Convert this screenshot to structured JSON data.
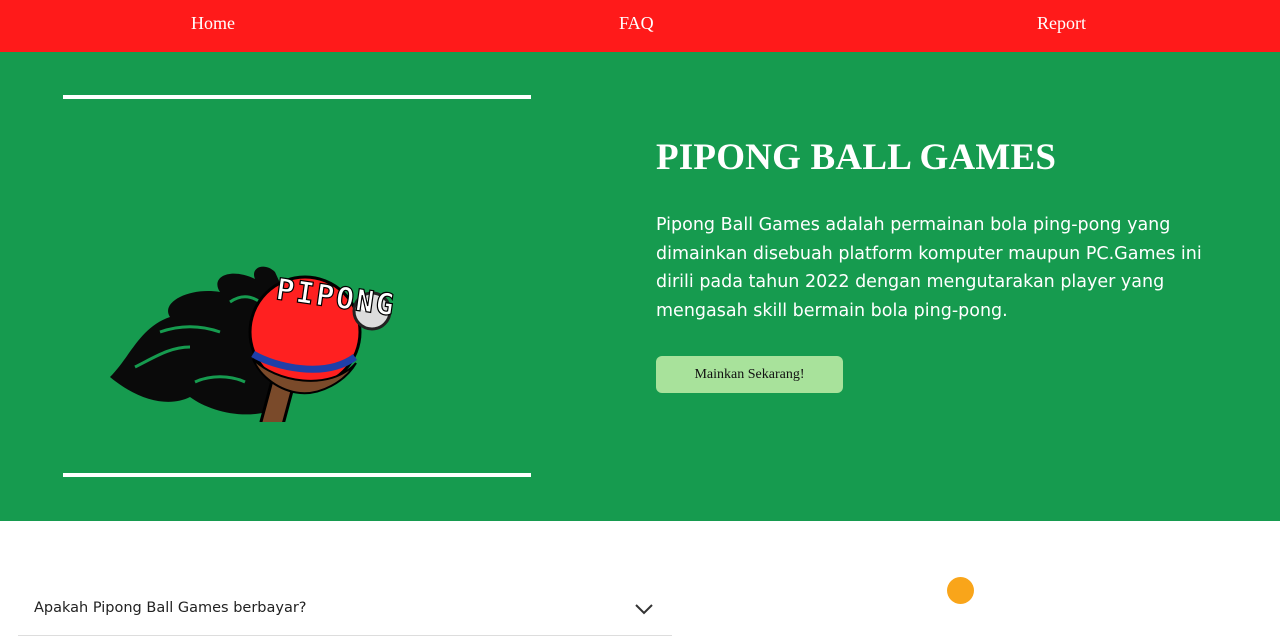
{
  "nav": {
    "home": "Home",
    "faq": "FAQ",
    "report": "Report"
  },
  "hero": {
    "logo_text": "PIPONG",
    "title": "PIPONG BALL GAMES",
    "description": "Pipong Ball Games adalah permainan bola ping-pong yang dimainkan disebuah platform komputer maupun PC.Games ini dirili pada tahun 2022 dengan mengutarakan player yang mengasah skill bermain bola ping-pong.",
    "cta_label": "Mainkan Sekarang!"
  },
  "faq": {
    "items": [
      {
        "question": "Apakah Pipong Ball Games berbayar?"
      }
    ]
  },
  "colors": {
    "nav_bg": "#ff1a1a",
    "hero_bg": "#169b4f",
    "cta_bg": "#a8e29b",
    "accent_dot": "#f9a51a"
  },
  "icons": {
    "faq_toggle": "chevron-down-icon",
    "logo": "ping-pong-paddle-logo"
  }
}
